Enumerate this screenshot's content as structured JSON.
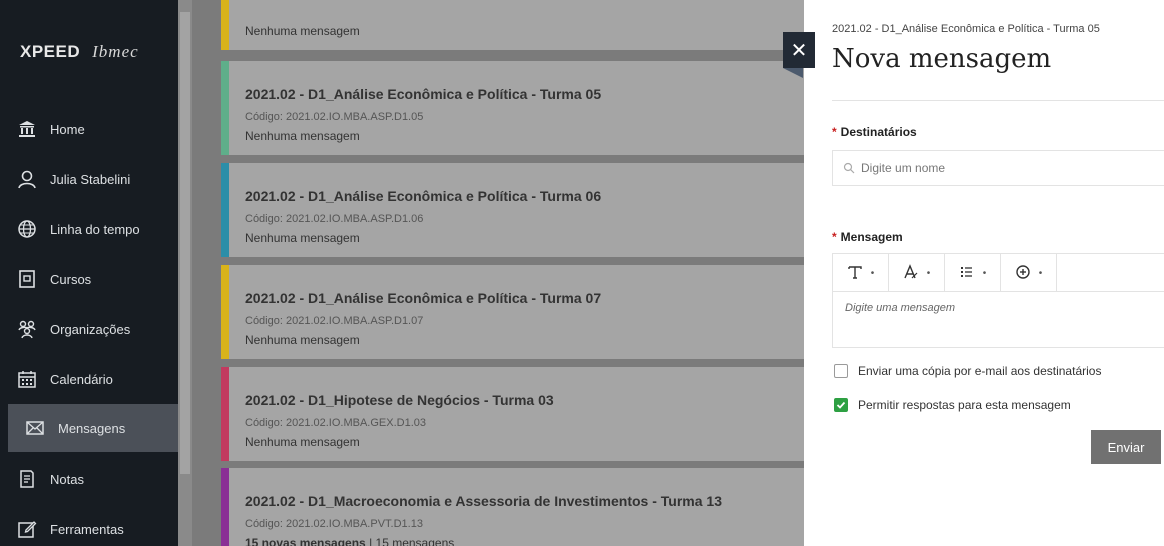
{
  "sidebar": {
    "logo_brand": "XPEED",
    "logo_school": "Ibmec",
    "items": [
      {
        "label": "Home"
      },
      {
        "label": "Julia Stabelini"
      },
      {
        "label": "Linha do tempo"
      },
      {
        "label": "Cursos"
      },
      {
        "label": "Organizações"
      },
      {
        "label": "Calendário"
      },
      {
        "label": "Mensagens"
      },
      {
        "label": "Notas"
      },
      {
        "label": "Ferramentas"
      }
    ],
    "active_item": "Mensagens"
  },
  "courses": [
    {
      "title": "",
      "code": "",
      "messages": "Nenhuma mensagem",
      "color": "#d9b31a"
    },
    {
      "title": "2021.02 - D1_Análise Econômica e Política - Turma 05",
      "code": "Código: 2021.02.IO.MBA.ASP.D1.05",
      "messages": "Nenhuma mensagem",
      "color": "#5fae8a"
    },
    {
      "title": "2021.02 - D1_Análise Econômica e Política - Turma 06",
      "code": "Código: 2021.02.IO.MBA.ASP.D1.06",
      "messages": "Nenhuma mensagem",
      "color": "#2b8ea8"
    },
    {
      "title": "2021.02 - D1_Análise Econômica e Política - Turma 07",
      "code": "Código: 2021.02.IO.MBA.ASP.D1.07",
      "messages": "Nenhuma mensagem",
      "color": "#d9b31a"
    },
    {
      "title": "2021.02 - D1_Hipotese de Negócios - Turma 03",
      "code": "Código: 2021.02.IO.MBA.GEX.D1.03",
      "messages": "Nenhuma mensagem",
      "color": "#c23a5f"
    },
    {
      "title": "2021.02 - D1_Macroeconomia e Assessoria de Investimentos - Turma 13",
      "code": "Código: 2021.02.IO.MBA.PVT.D1.13",
      "messages_bold": "15 novas mensagens",
      "messages_rest": " | 15 mensagens",
      "color": "#8a2f95"
    }
  ],
  "panel": {
    "breadcrumb": "2021.02 - D1_Análise Econômica e Política - Turma 05",
    "title": "Nova mensagem",
    "recipients_label": "Destinatários",
    "recipients_placeholder": "Digite um nome",
    "message_label": "Mensagem",
    "message_placeholder": "Digite uma mensagem",
    "required_mark": "*",
    "copy_email_label": "Enviar uma cópia por e-mail aos destinatários",
    "copy_email_checked": false,
    "allow_replies_label": "Permitir respostas para esta mensagem",
    "allow_replies_checked": true,
    "send_label": "Enviar",
    "close_label": "✕"
  },
  "colors": {
    "sidebar_bg": "#171c22",
    "checkbox_on": "#2ea043",
    "required": "#c82020"
  },
  "icons": [
    "bank-icon",
    "user-icon",
    "globe-icon",
    "course-icon",
    "organizations-icon",
    "calendar-icon",
    "mail-icon",
    "grades-icon",
    "tools-icon",
    "search-icon",
    "text-format-icon",
    "text-style-icon",
    "list-icon",
    "insert-icon",
    "close-icon",
    "check-icon"
  ]
}
